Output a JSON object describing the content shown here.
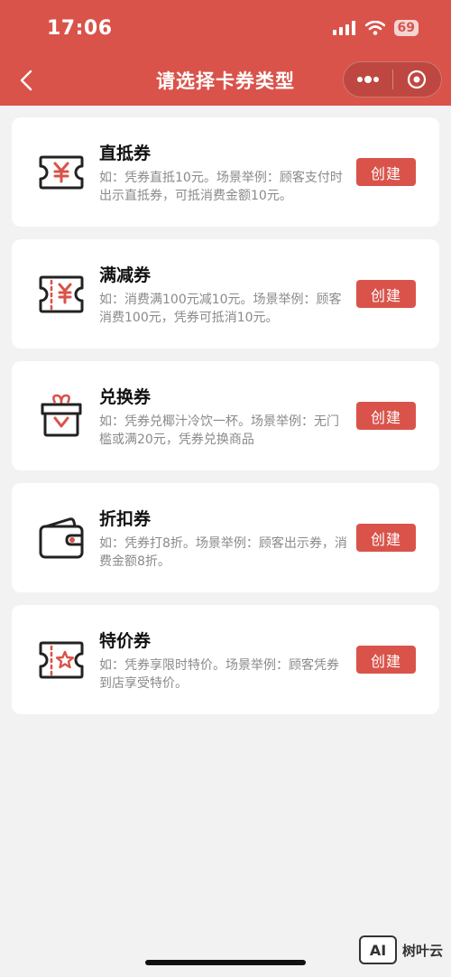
{
  "status_bar": {
    "time": "17:06",
    "battery": "69"
  },
  "nav": {
    "title": "请选择卡券类型"
  },
  "colors": {
    "accent": "#d9534a",
    "icon_stroke": "#222222",
    "background": "#f2f2f2"
  },
  "coupons": [
    {
      "icon": "yen-ticket-icon",
      "title": "直抵券",
      "desc": "如：凭券直抵10元。场景举例：顾客支付时出示直抵券，可抵消费金额10元。",
      "button": "创建"
    },
    {
      "icon": "discount-ticket-icon",
      "title": "满减券",
      "desc": "如：消费满100元减10元。场景举例：顾客消费100元，凭券可抵消10元。",
      "button": "创建"
    },
    {
      "icon": "gift-box-icon",
      "title": "兑换券",
      "desc": "如：凭券兑椰汁冷饮一杯。场景举例：无门槛或满20元，凭券兑换商品",
      "button": "创建"
    },
    {
      "icon": "wallet-icon",
      "title": "折扣券",
      "desc": "如：凭券打8折。场景举例：顾客出示券，消费金额8折。",
      "button": "创建"
    },
    {
      "icon": "star-ticket-icon",
      "title": "特价券",
      "desc": "如：凭券享限时特价。场景举例：顾客凭券到店享受特价。",
      "button": "创建"
    }
  ],
  "watermark": {
    "logo": "AI",
    "text": "树叶云"
  }
}
